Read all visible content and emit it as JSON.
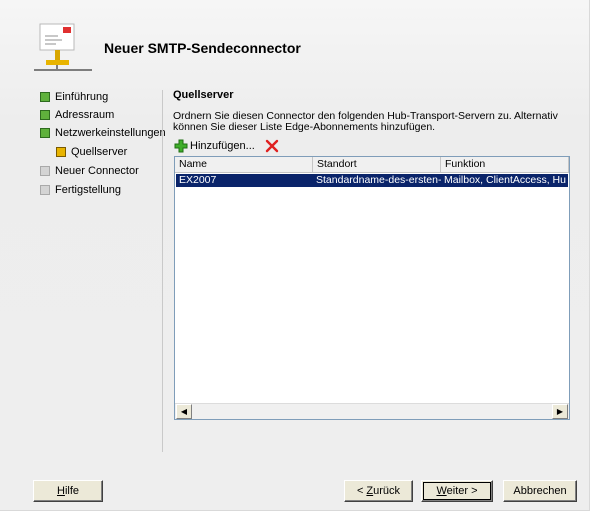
{
  "wizard": {
    "title": "Neuer SMTP-Sendeconnector"
  },
  "steps": [
    {
      "label": "Einführung",
      "state": "done"
    },
    {
      "label": "Adressraum",
      "state": "done"
    },
    {
      "label": "Netzwerkeinstellungen",
      "state": "done"
    },
    {
      "label": "Quellserver",
      "state": "current"
    },
    {
      "label": "Neuer Connector",
      "state": "pending"
    },
    {
      "label": "Fertigstellung",
      "state": "pending"
    }
  ],
  "main": {
    "section_title": "Quellserver",
    "description": "Ordnern Sie diesen Connector den folgenden Hub-Transport-Servern zu. Alternativ können Sie dieser Liste Edge-Abonnements hinzufügen.",
    "toolbar": {
      "add_label": "Hinzufügen...",
      "add_icon": "green-plus-icon",
      "remove_icon": "red-x-icon"
    },
    "table": {
      "columns": [
        "Name",
        "Standort",
        "Funktion"
      ],
      "rows": [
        {
          "name": "EX2007",
          "site": "Standardname-des-ersten-...",
          "role": "Mailbox, ClientAccess, Hu",
          "selected": true
        }
      ]
    }
  },
  "buttons": {
    "help": {
      "prefix": "",
      "mnemonic": "H",
      "suffix": "ilfe"
    },
    "back": {
      "prefix": "< ",
      "mnemonic": "Z",
      "suffix": "urück"
    },
    "next": {
      "prefix": "",
      "mnemonic": "W",
      "suffix": "eiter >"
    },
    "cancel": {
      "label": "Abbrechen"
    }
  },
  "colors": {
    "step_done": "#5fb13c",
    "step_current": "#e8b400",
    "step_pending": "#d4d4d4",
    "selection": "#0a246a"
  }
}
